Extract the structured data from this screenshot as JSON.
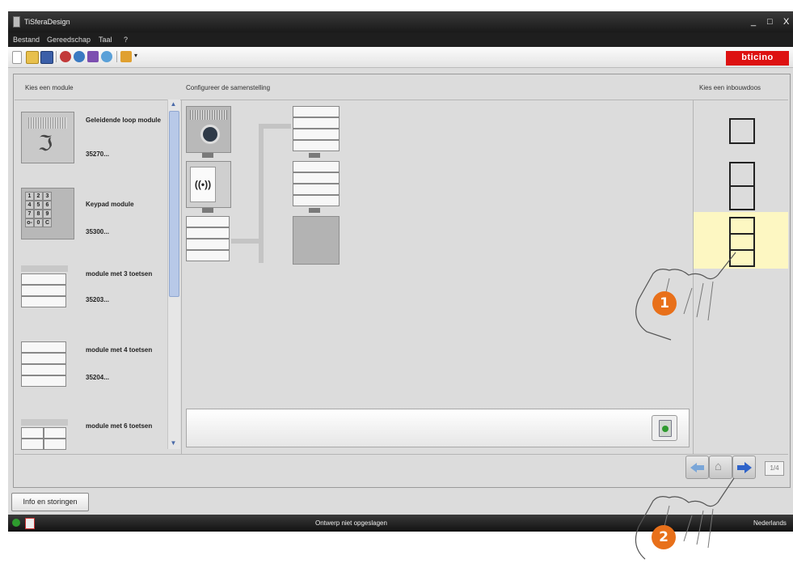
{
  "window": {
    "title": "TiSferaDesign",
    "controls": [
      "_",
      "□",
      "X"
    ]
  },
  "menu": [
    "Bestand",
    "Gereedschap",
    "Taal",
    "?"
  ],
  "toolbar": {
    "icons": [
      "new-icon",
      "open-icon",
      "save-icon",
      "device-icon",
      "device-icon",
      "tools-icon",
      "connect-icon",
      "project-icon"
    ]
  },
  "brand": {
    "logo_text": "bticino",
    "color": "#d11111"
  },
  "left_panel": {
    "header": "Kies een module",
    "modules": [
      {
        "name": "Geleidende loop module",
        "code": "35270..."
      },
      {
        "name": "Keypad module",
        "code": "35300..."
      },
      {
        "name": "module met 3 toetsen",
        "code": "35203..."
      },
      {
        "name": "module met 4 toetsen",
        "code": "35204..."
      },
      {
        "name": "module met 6 toetsen",
        "code": ""
      }
    ],
    "keypad_keys": [
      "1",
      "2",
      "3",
      "4",
      "5",
      "6",
      "7",
      "8",
      "9",
      "o-",
      "0",
      "C"
    ],
    "keypad_highlight_color": "#b8c9e8"
  },
  "center_panel": {
    "header": "Configureer de samenstelling"
  },
  "right_panel": {
    "header": "Kies een inbouwdoos",
    "selected_index": 2,
    "selected_color": "#fdf7c2"
  },
  "nav": {
    "page_indicator": "1/4"
  },
  "bottom": {
    "info_button": "Info en storingen"
  },
  "status": {
    "text": "Ontwerp niet opgeslagen",
    "language": "Nederlands",
    "ok_color": "#2e9b2e"
  },
  "annotations": {
    "badge1": "1",
    "badge2": "2",
    "color": "#e8701a"
  }
}
